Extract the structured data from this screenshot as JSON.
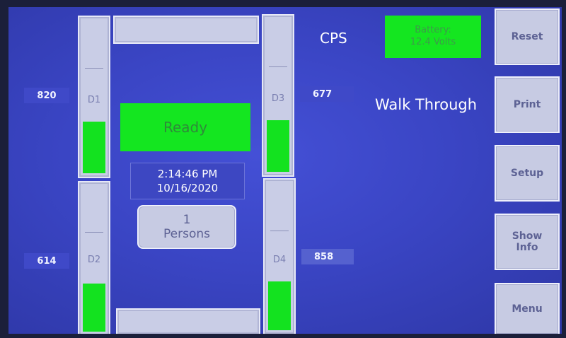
{
  "readouts": {
    "d1_value": "820",
    "d2_value": "614",
    "d3_value": "677",
    "d4_value": "858"
  },
  "sensors": {
    "d1": {
      "label": "D1",
      "level": 0.34
    },
    "d2": {
      "label": "D2",
      "level": 0.33
    },
    "d3": {
      "label": "D3",
      "level": 0.34
    },
    "d4": {
      "label": "D4",
      "level": 0.33
    }
  },
  "status": {
    "text": "Ready",
    "color": "#14e620"
  },
  "clock": {
    "time": "2:14:46 PM",
    "date": "10/16/2020"
  },
  "persons": {
    "count": "1",
    "label": "Persons"
  },
  "header": {
    "cps_label": "CPS",
    "mode": "Walk Through"
  },
  "battery": {
    "line1": "Battery:",
    "line2": "12.4 Volts",
    "color": "#14e620"
  },
  "menu": {
    "reset": "Reset",
    "print": "Print",
    "setup": "Setup",
    "show_info_line1": "Show",
    "show_info_line2": "Info",
    "menu": "Menu"
  },
  "colors": {
    "background": "#3a45c4",
    "indicator_green": "#13e21f",
    "button_face": "#c7cbe3"
  }
}
